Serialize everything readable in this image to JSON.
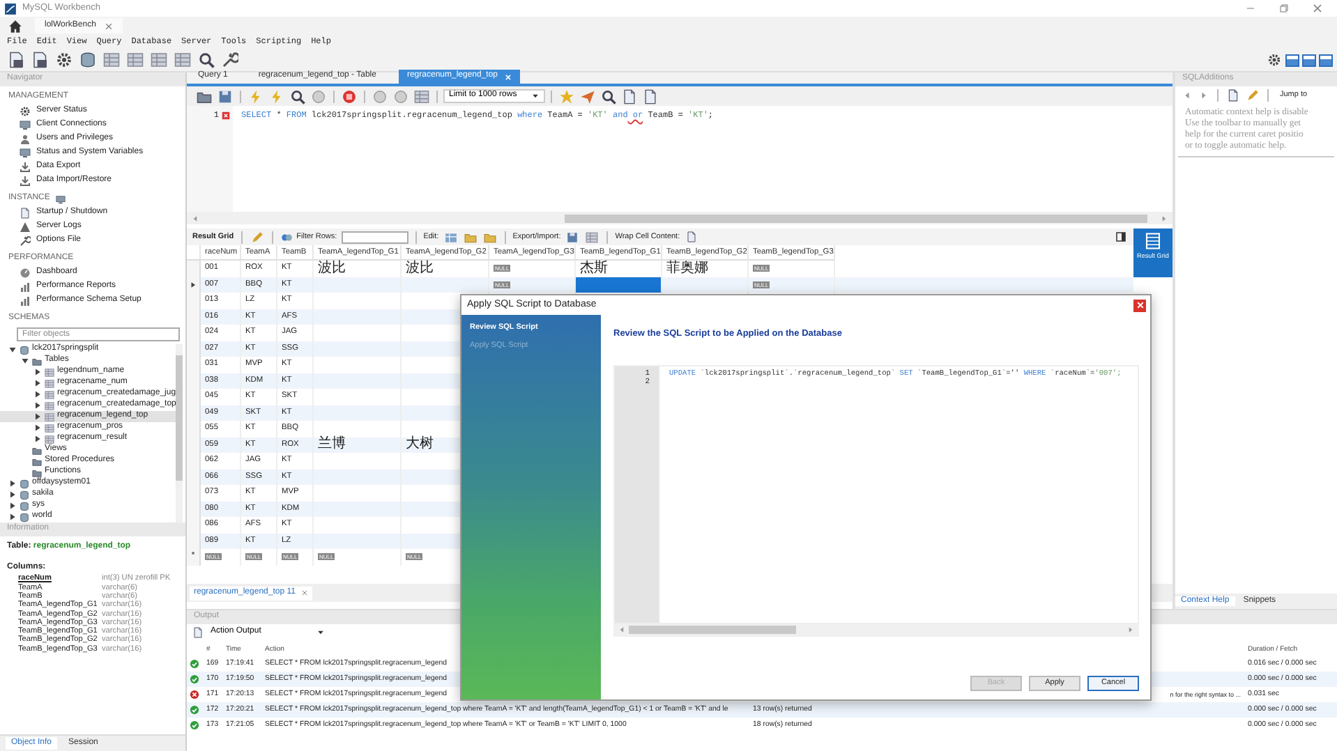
{
  "window": {
    "title": "MySQL Workbench"
  },
  "connection_tabs": [
    {
      "label": "lolWorkBench",
      "selected": true
    }
  ],
  "menu": [
    "File",
    "Edit",
    "View",
    "Query",
    "Database",
    "Server",
    "Tools",
    "Scripting",
    "Help"
  ],
  "layout_toggles": [
    {
      "on": true
    },
    {
      "on": true
    },
    {
      "on": true
    }
  ],
  "navigator": {
    "title": "Navigator",
    "sections": [
      {
        "title": "MANAGEMENT",
        "items": [
          "Server Status",
          "Client Connections",
          "Users and Privileges",
          "Status and System Variables",
          "Data Export",
          "Data Import/Restore"
        ]
      },
      {
        "title": "INSTANCE",
        "items": [
          "Startup / Shutdown",
          "Server Logs",
          "Options File"
        ]
      },
      {
        "title": "PERFORMANCE",
        "items": [
          "Dashboard",
          "Performance Reports",
          "Performance Schema Setup"
        ]
      }
    ],
    "schemas": {
      "title": "SCHEMAS",
      "filter_placeholder": "Filter objects",
      "tree": [
        {
          "label": "lck2017springsplit",
          "expanded": true,
          "selected": false,
          "children": [
            {
              "label": "Tables",
              "expanded": true,
              "selected": false,
              "children": [
                {
                  "label": "legendnum_name",
                  "expanded": false,
                  "selected": false
                },
                {
                  "label": "regracename_num",
                  "expanded": false,
                  "selected": false
                },
                {
                  "label": "regracenum_createdamage_jug",
                  "expanded": false,
                  "selected": false
                },
                {
                  "label": "regracenum_createdamage_top",
                  "expanded": false,
                  "selected": false
                },
                {
                  "label": "regracenum_legend_top",
                  "expanded": false,
                  "selected": true
                },
                {
                  "label": "regracenum_pros",
                  "expanded": false,
                  "selected": false
                },
                {
                  "label": "regracenum_result",
                  "expanded": false,
                  "selected": false
                }
              ]
            },
            {
              "label": "Views",
              "selected": false
            },
            {
              "label": "Stored Procedures",
              "selected": false
            },
            {
              "label": "Functions",
              "selected": false
            }
          ]
        },
        {
          "label": "offdaysystem01",
          "expanded": false,
          "selected": false
        },
        {
          "label": "sakila",
          "expanded": false,
          "selected": false
        },
        {
          "label": "sys",
          "expanded": false,
          "selected": false
        },
        {
          "label": "world",
          "expanded": false,
          "selected": false
        }
      ]
    },
    "information": {
      "title": "Information",
      "table_label": "Table:",
      "table_name": "regracenum_legend_top",
      "columns_label": "Columns:",
      "columns": [
        {
          "name": "raceNum",
          "type": "int(3) UN zerofill PK",
          "primary": true
        },
        {
          "name": "TeamA",
          "type": "varchar(6)",
          "primary": false
        },
        {
          "name": "TeamB",
          "type": "varchar(6)",
          "primary": false
        },
        {
          "name": "TeamA_legendTop_G1",
          "type": "varchar(16)",
          "primary": false
        },
        {
          "name": "TeamA_legendTop_G2",
          "type": "varchar(16)",
          "primary": false
        },
        {
          "name": "TeamA_legendTop_G3",
          "type": "varchar(16)",
          "primary": false
        },
        {
          "name": "TeamB_legendTop_G1",
          "type": "varchar(16)",
          "primary": false
        },
        {
          "name": "TeamB_legendTop_G2",
          "type": "varchar(16)",
          "primary": false
        },
        {
          "name": "TeamB_legendTop_G3",
          "type": "varchar(16)",
          "primary": false
        }
      ]
    },
    "bottom_tabs": [
      {
        "label": "Object Info",
        "selected": true
      },
      {
        "label": "Session",
        "selected": false
      }
    ]
  },
  "editor": {
    "tabs": [
      {
        "label": "Query 1",
        "selected": false,
        "closable": false
      },
      {
        "label": "regracenum_legend_top - Table",
        "selected": false,
        "closable": false
      },
      {
        "label": "regracenum_legend_top",
        "selected": true,
        "closable": true
      }
    ],
    "limit": "Limit to 1000 rows",
    "lines": [
      {
        "number": "1",
        "error": true,
        "tokens": [
          {
            "text": "SELECT",
            "kind": "keyword"
          },
          {
            "text": " * ",
            "kind": "plain"
          },
          {
            "text": "FROM",
            "kind": "keyword"
          },
          {
            "text": " lck2017springsplit.regracenum_legend_top ",
            "kind": "plain"
          },
          {
            "text": "where",
            "kind": "keyword"
          },
          {
            "text": " TeamA = ",
            "kind": "plain"
          },
          {
            "text": "'KT'",
            "kind": "string"
          },
          {
            "text": " and",
            "kind": "keyword"
          },
          {
            "text": " or",
            "kind": "error"
          },
          {
            "text": " TeamB = ",
            "kind": "plain"
          },
          {
            "text": "'KT'",
            "kind": "string"
          },
          {
            "text": ";",
            "kind": "plain"
          }
        ]
      }
    ]
  },
  "result": {
    "toolbar": {
      "result_grid": "Result Grid",
      "filter_label": "Filter Rows:",
      "edit_label": "Edit:",
      "export_label": "Export/Import:",
      "wrap_label": "Wrap Cell Content:"
    },
    "columns": [
      "raceNum",
      "TeamA",
      "TeamB",
      "TeamA_legendTop_G1",
      "TeamA_legendTop_G2",
      "TeamA_legendTop_G3",
      "TeamB_legendTop_G1",
      "TeamB_legendTop_G2",
      "TeamB_legendTop_G3"
    ],
    "rows": [
      {
        "current": false,
        "cells": [
          "001",
          "ROX",
          "KT",
          "波比",
          "波比",
          {
            "kind": "null",
            "text": "NULL"
          },
          "杰斯",
          "菲奥娜",
          {
            "kind": "null",
            "text": "NULL"
          }
        ]
      },
      {
        "current": true,
        "cells": [
          "007",
          "BBQ",
          "KT",
          null,
          null,
          {
            "kind": "null",
            "text": "NULL"
          },
          {
            "kind": "active"
          },
          null,
          {
            "kind": "null",
            "text": "NULL"
          }
        ]
      },
      {
        "current": false,
        "cells": [
          "013",
          "LZ",
          "KT"
        ]
      },
      {
        "current": false,
        "cells": [
          "016",
          "KT",
          "AFS"
        ]
      },
      {
        "current": false,
        "cells": [
          "024",
          "KT",
          "JAG"
        ]
      },
      {
        "current": false,
        "cells": [
          "027",
          "KT",
          "SSG"
        ]
      },
      {
        "current": false,
        "cells": [
          "031",
          "MVP",
          "KT"
        ]
      },
      {
        "current": false,
        "cells": [
          "038",
          "KDM",
          "KT"
        ]
      },
      {
        "current": false,
        "cells": [
          "045",
          "KT",
          "SKT"
        ]
      },
      {
        "current": false,
        "cells": [
          "049",
          "SKT",
          "KT"
        ]
      },
      {
        "current": false,
        "cells": [
          "055",
          "KT",
          "BBQ"
        ]
      },
      {
        "current": false,
        "cells": [
          "059",
          "KT",
          "ROX",
          "兰博",
          "大树"
        ]
      },
      {
        "current": false,
        "cells": [
          "062",
          "JAG",
          "KT"
        ]
      },
      {
        "current": false,
        "cells": [
          "066",
          "SSG",
          "KT"
        ]
      },
      {
        "current": false,
        "cells": [
          "073",
          "KT",
          "MVP"
        ]
      },
      {
        "current": false,
        "cells": [
          "080",
          "KT",
          "KDM"
        ]
      },
      {
        "current": false,
        "cells": [
          "086",
          "AFS",
          "KT"
        ]
      },
      {
        "current": false,
        "cells": [
          "089",
          "KT",
          "LZ"
        ]
      },
      {
        "current": false,
        "header": "*",
        "cells": [
          {
            "kind": "null",
            "text": "NULL"
          },
          {
            "kind": "null",
            "text": "NULL"
          },
          {
            "kind": "null",
            "text": "NULL"
          },
          {
            "kind": "null",
            "text": "NULL"
          },
          {
            "kind": "null",
            "text": "NULL"
          }
        ]
      }
    ],
    "view_buttons": [
      {
        "label": "Result Grid",
        "selected": true
      }
    ],
    "tabs": [
      {
        "label": "regracenum_legend_top 11",
        "closable": true
      }
    ]
  },
  "sql_additions": {
    "title": "SQLAdditions",
    "jump_to": "Jump to",
    "help_lines": [
      "Automatic context help is disable",
      "Use the toolbar to manually get",
      "help for the current caret positio",
      "or to toggle automatic help."
    ],
    "tabs": [
      {
        "label": "Context Help",
        "selected": true
      },
      {
        "label": "Snippets",
        "selected": false
      }
    ]
  },
  "output": {
    "title": "Output",
    "selector": "Action Output",
    "columns": [
      "#",
      "Time",
      "Action",
      "Duration / Fetch"
    ],
    "rows": [
      {
        "failed": false,
        "number": "169",
        "time": "17:19:41",
        "action": "SELECT * FROM lck2017springsplit.regracenum_legend",
        "duration": "0.016 sec / 0.000 sec"
      },
      {
        "failed": false,
        "number": "170",
        "time": "17:19:50",
        "action": "SELECT * FROM lck2017springsplit.regracenum_legend",
        "duration": "0.000 sec / 0.000 sec"
      },
      {
        "failed": true,
        "number": "171",
        "time": "17:20:13",
        "action": "SELECT * FROM lck2017springsplit.regracenum_legend",
        "message": "n for the right syntax to ...",
        "duration": "0.031 sec"
      },
      {
        "failed": false,
        "number": "172",
        "time": "17:20:21",
        "action": "SELECT * FROM lck2017springsplit.regracenum_legend_top where TeamA = 'KT' and length(TeamA_legendTop_G1) < 1 or TeamB = 'KT' and le",
        "message": "13 row(s) returned",
        "duration": "0.000 sec / 0.000 sec"
      },
      {
        "failed": false,
        "number": "173",
        "time": "17:21:05",
        "action": "SELECT * FROM lck2017springsplit.regracenum_legend_top where TeamA = 'KT' or TeamB = 'KT' LIMIT 0, 1000",
        "message": "18 row(s) returned",
        "duration": "0.000 sec / 0.000 sec"
      }
    ]
  },
  "dialog": {
    "title": "Apply SQL Script to Database",
    "steps": [
      {
        "label": "Review SQL Script",
        "selected": true
      },
      {
        "label": "Apply SQL Script",
        "selected": false
      }
    ],
    "heading": "Review the SQL Script to be Applied on the Database",
    "script_lines": [
      {
        "number": "1",
        "tokens": [
          {
            "text": "UPDATE",
            "kind": "keyword"
          },
          {
            "text": " `lck2017springsplit`.`regracenum_legend_top` ",
            "kind": "plain"
          },
          {
            "text": "SET",
            "kind": "keyword"
          },
          {
            "text": " `TeamB_legendTop_G1`='' ",
            "kind": "plain"
          },
          {
            "text": "WHERE",
            "kind": "keyword"
          },
          {
            "text": " `raceNum`=",
            "kind": "plain"
          },
          {
            "text": "'007';",
            "kind": "string"
          }
        ]
      },
      {
        "number": "2"
      }
    ],
    "buttons": [
      {
        "label": "Back",
        "disabled": true,
        "focused": false
      },
      {
        "label": "Apply",
        "disabled": false,
        "focused": false
      },
      {
        "label": "Cancel",
        "disabled": false,
        "focused": true
      }
    ]
  }
}
